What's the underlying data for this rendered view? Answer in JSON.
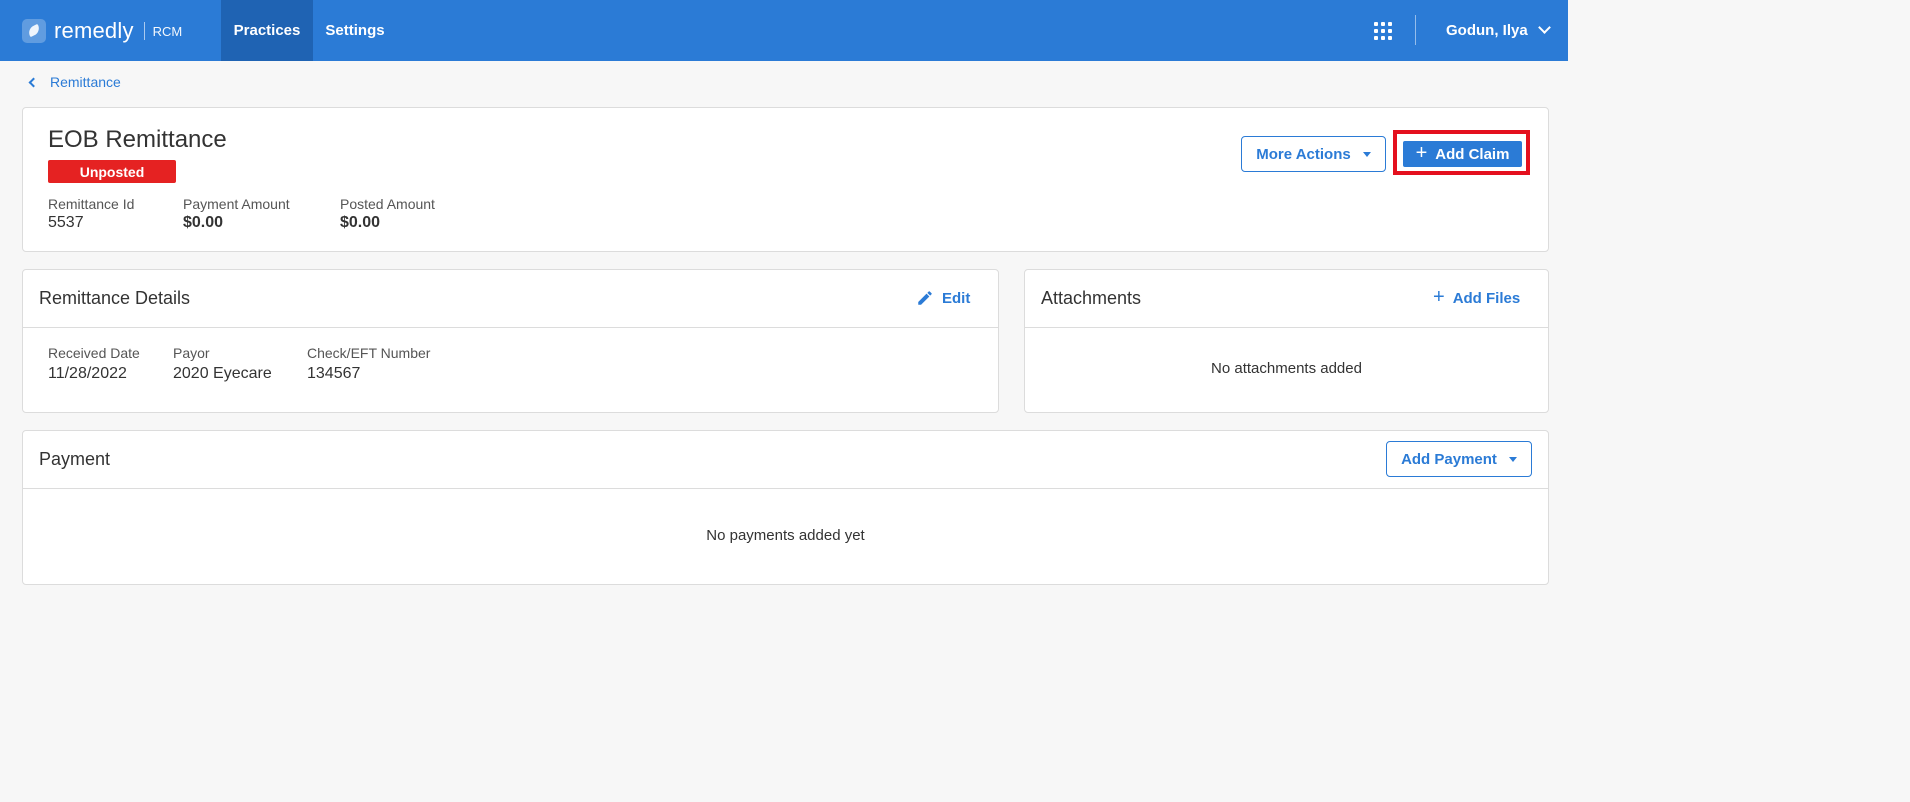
{
  "topbar": {
    "brand": "remedly",
    "brand_sub": "RCM",
    "nav": [
      "Practices",
      "Settings"
    ],
    "active_nav": "Practices",
    "user_name": "Godun, Ilya",
    "colors": {
      "bar": "#2b7bd6",
      "active_tab": "#1f63b3"
    }
  },
  "breadcrumb": {
    "label": "Remittance"
  },
  "header": {
    "title": "EOB Remittance",
    "status": "Unposted",
    "status_color": "#e52222",
    "meta": [
      {
        "label": "Remittance Id",
        "value": "5537"
      },
      {
        "label": "Payment Amount",
        "value": "$0.00"
      },
      {
        "label": "Posted Amount",
        "value": "$0.00"
      }
    ],
    "more_actions_label": "More Actions",
    "add_claim_label": "Add Claim"
  },
  "details": {
    "title": "Remittance Details",
    "edit_label": "Edit",
    "fields": [
      {
        "label": "Received Date",
        "value": "11/28/2022"
      },
      {
        "label": "Payor",
        "value": "2020 Eyecare"
      },
      {
        "label": "Check/EFT Number",
        "value": "134567"
      }
    ]
  },
  "attachments": {
    "title": "Attachments",
    "add_label": "Add Files",
    "empty_text": "No attachments added"
  },
  "payment": {
    "title": "Payment",
    "add_label": "Add Payment",
    "empty_text": "No payments added yet"
  }
}
